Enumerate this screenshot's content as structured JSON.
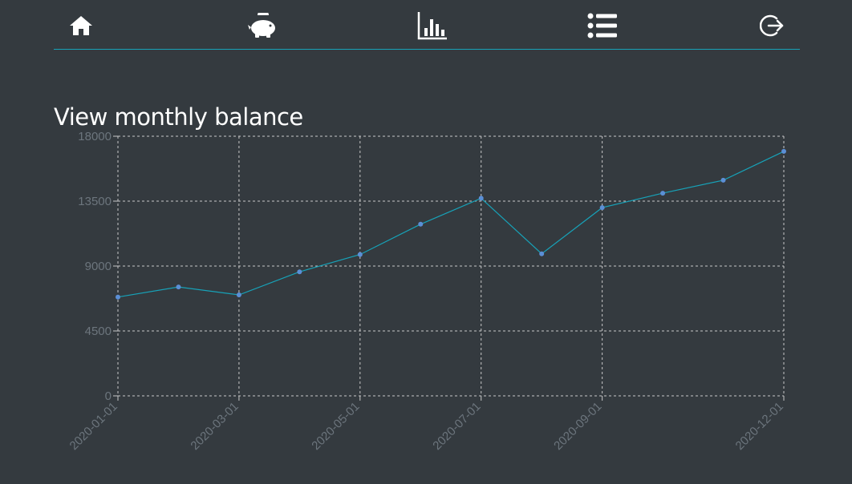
{
  "nav": {
    "items": [
      {
        "icon": "home-icon"
      },
      {
        "icon": "piggy-bank-icon"
      },
      {
        "icon": "bar-chart-icon"
      },
      {
        "icon": "list-icon"
      },
      {
        "icon": "sign-out-icon"
      }
    ],
    "accent_color": "#17a2b8"
  },
  "page": {
    "title": "View monthly balance"
  },
  "chart_data": {
    "type": "line",
    "title": "",
    "xlabel": "",
    "ylabel": "",
    "x": [
      "2020-01-01",
      "2020-02-01",
      "2020-03-01",
      "2020-04-01",
      "2020-05-01",
      "2020-06-01",
      "2020-07-01",
      "2020-08-01",
      "2020-09-01",
      "2020-10-01",
      "2020-11-01",
      "2020-12-01"
    ],
    "series": [
      {
        "values": [
          6850,
          7550,
          7000,
          8600,
          9800,
          11900,
          13700,
          9850,
          13050,
          14050,
          14950,
          16950
        ]
      }
    ],
    "ylim": [
      0,
      18000
    ],
    "yticks": [
      0,
      4500,
      9000,
      13500,
      18000
    ],
    "xticks": [
      "2020-01-01",
      "2020-03-01",
      "2020-05-01",
      "2020-07-01",
      "2020-09-01",
      "2020-12-01"
    ],
    "grid": true,
    "line_color": "#17a2b8",
    "point_color": "#5b8fd6"
  }
}
